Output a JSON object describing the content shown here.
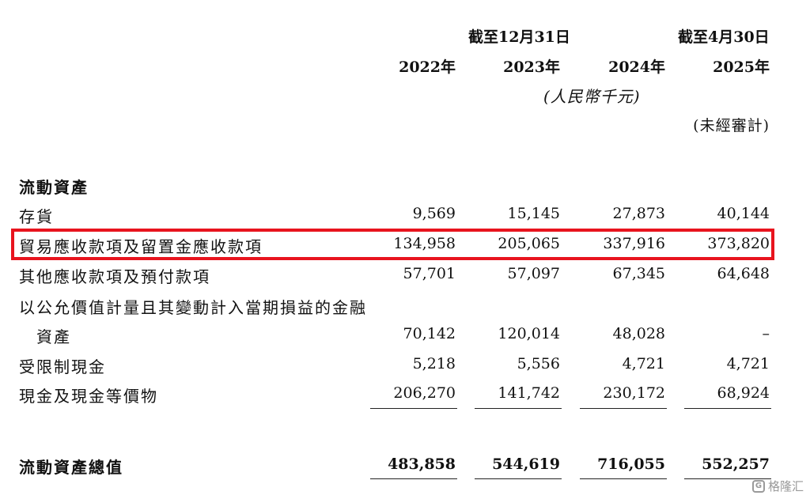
{
  "header": {
    "period_dec": "截至12月31日",
    "period_apr": "截至4月30日",
    "years": [
      "2022年",
      "2023年",
      "2024年",
      "2025年"
    ],
    "unit": "(人民幣千元)",
    "unaudited": "(未經審計)"
  },
  "section_title": "流動資產",
  "rows": [
    {
      "label": "存貨",
      "values": [
        "9,569",
        "15,145",
        "27,873",
        "40,144"
      ]
    },
    {
      "label": "貿易應收款項及留置金應收款項",
      "values": [
        "134,958",
        "205,065",
        "337,916",
        "373,820"
      ]
    },
    {
      "label": "其他應收款項及預付款項",
      "values": [
        "57,701",
        "57,097",
        "67,345",
        "64,648"
      ]
    },
    {
      "label": "以公允價值計量且其變動計入當期損益的金融",
      "values": [
        "",
        "",
        "",
        ""
      ]
    },
    {
      "label": "資產",
      "values": [
        "70,142",
        "120,014",
        "48,028",
        "–"
      ]
    },
    {
      "label": "受限制現金",
      "values": [
        "5,218",
        "5,556",
        "4,721",
        "4,721"
      ]
    },
    {
      "label": "現金及現金等價物",
      "values": [
        "206,270",
        "141,742",
        "230,172",
        "68,924"
      ]
    }
  ],
  "total": {
    "label": "流動資產總值",
    "values": [
      "483,858",
      "544,619",
      "716,055",
      "552,257"
    ]
  },
  "watermark": {
    "icon": "gelonghui-logo-icon",
    "mark": "G",
    "text": "格隆汇"
  },
  "colors": {
    "highlight": "#e8141e",
    "text": "#111111"
  }
}
